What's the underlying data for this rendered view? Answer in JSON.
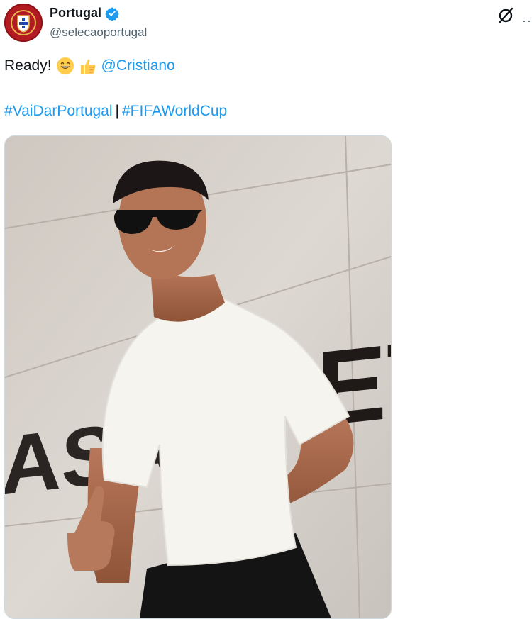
{
  "account": {
    "display_name": "Portugal",
    "handle": "@selecaoportugal",
    "verified": true,
    "avatar_icon": "portugal-federation-crest",
    "accent_color": "#1d9bf0",
    "avatar_color": "#b31b22"
  },
  "tweet": {
    "text_prefix": "Ready!",
    "emojis": [
      "grinning-face-emoji",
      "thumbs-up-emoji"
    ],
    "mention": "@Cristiano",
    "hashtag_1": "#VaiDarPortugal",
    "separator": "|",
    "hashtag_2": "#FIFAWorldCup"
  },
  "media": {
    "image_icon": "player-photo",
    "wall_text": "ASA",
    "wall_text_right": "ET"
  },
  "toolbar": {
    "grok_icon": "grok-icon",
    "more_icon": "more-options-icon"
  }
}
